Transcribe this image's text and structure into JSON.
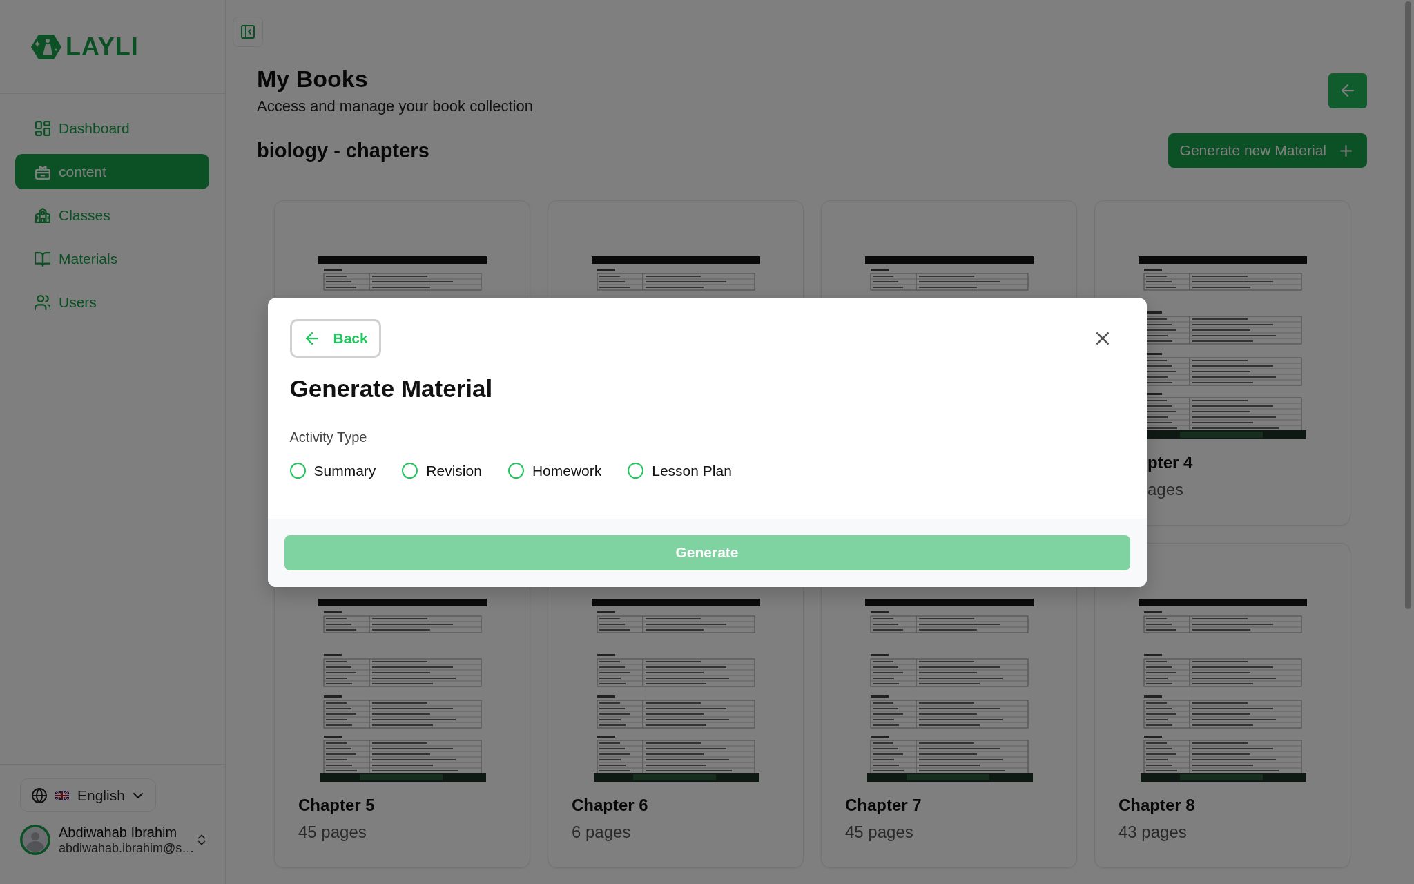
{
  "sidebar": {
    "logo": "LAYLI",
    "items": [
      {
        "label": "Dashboard",
        "selected": false
      },
      {
        "label": "content",
        "selected": true
      },
      {
        "label": "Classes",
        "selected": false
      },
      {
        "label": "Materials",
        "selected": false
      },
      {
        "label": "Users",
        "selected": false
      }
    ],
    "language": {
      "label": "English"
    },
    "user": {
      "name": "Abdiwahab Ibrahim",
      "email": "abdiwahab.ibrahim@s…"
    }
  },
  "header": {
    "title": "My Books",
    "subtitle": "Access and manage your book collection",
    "section": "biology - chapters",
    "new_material_button": "Generate new Material"
  },
  "books": [
    {
      "kind": "document"
    },
    {
      "kind": "document"
    },
    {
      "kind": "document"
    },
    {
      "kind": "document",
      "title": "pter 4",
      "pages": "ages"
    },
    {
      "kind": "document",
      "title": "Chapter 5",
      "pages": "45 pages"
    },
    {
      "kind": "document",
      "title": "Chapter 6",
      "pages": "6 pages"
    },
    {
      "kind": "document",
      "title": "Chapter 7",
      "pages": "45 pages"
    },
    {
      "kind": "document",
      "title": "Chapter 8",
      "pages": "43 pages"
    }
  ],
  "modal": {
    "back": {
      "label": "Back",
      "focused": true
    },
    "title": "Generate Material",
    "field_label": "Activity Type",
    "options": [
      {
        "label": "Summary",
        "selected": false
      },
      {
        "label": "Revision",
        "selected": false
      },
      {
        "label": "Homework",
        "selected": false
      },
      {
        "label": "Lesson Plan",
        "selected": false
      }
    ],
    "submit": {
      "label": "Generate",
      "disabled": true
    }
  }
}
